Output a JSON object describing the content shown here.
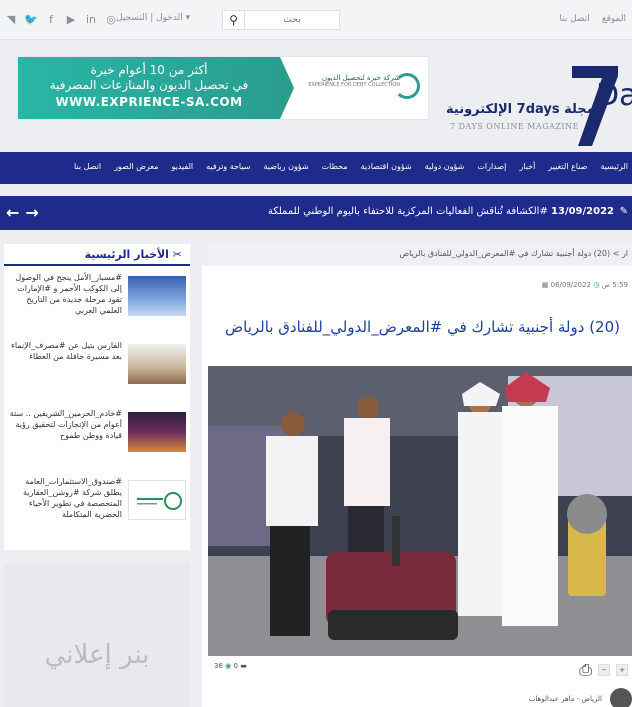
{
  "topbar": {
    "social_icons": [
      "rss-icon",
      "twitter-icon",
      "facebook-icon",
      "youtube-icon",
      "linkedin-icon",
      "instagram-icon"
    ],
    "social_glyphs": [
      "◥",
      "🐦",
      "f",
      "▶",
      "in",
      "◎"
    ],
    "login_text": "▾ الدخول | التسجيل",
    "search_placeholder": "بحث",
    "links": [
      "الموقع",
      "اتصل بنا"
    ]
  },
  "ad": {
    "line1": "أكثر من 10 أعوام خبرة",
    "line2": "في تحصيل الديون والمنازعات المصرفية",
    "url": "WWW.EXPRIENCE-SA.COM",
    "company_ar": "شركة خبرة لتحصيل الديون",
    "company_en": "EXPERIENCE FOR DEBT COLLECTION"
  },
  "logo": {
    "day": "Day",
    "name_ar": "مجلة 7days الإلكترونية",
    "name_en": "7 DAYS ONLINE MAGAZINE"
  },
  "nav": {
    "items": [
      "الرئيسية",
      "صناع التغيير",
      "أخبار",
      "إصدارات",
      "شؤون دولية",
      "شؤون اقتصادية",
      "محطات",
      "شؤون رياضية",
      "سياحة وترفيه",
      "الفيديو",
      "معرض الصور",
      "اتصل بنا"
    ]
  },
  "ticker": {
    "date": "13/09/2022",
    "headline": "#الكشافة تُناقش الفعاليات المركزية للاحتفاء باليوم الوطني للمملكة"
  },
  "sidebar": {
    "title": "الأخبار الرئيسية",
    "items": [
      {
        "text": "#مسبار_الأمل ينجح في الوصول إلى الكوكب الأحمر و #الإمارات تقود مرحلة جديدة من التاريخ العلمي العربي"
      },
      {
        "text": "الفارس بتيل عن #مصرف_الإنماء بعد مسيرة حافلة من العطاء"
      },
      {
        "text": "#خادم_الحرمين_الشريفين .. ستة أعوام من الإنجازات لتحقيق رؤية قيادة ووطن طموح"
      },
      {
        "text": "#صندوق_الاستثمارات_العامة يطلق شركة #روشن_العقارية المتخصصة في تطوير الأحياء الحضرية المتكاملة"
      }
    ],
    "banner_text": "بنر إعلاني"
  },
  "article": {
    "breadcrumb": "ار > (20) دولة أجنبية تشارك في #المعرض_الدولي_للفنادق بالرياض",
    "date": "06/09/2022",
    "time": "5:59 ص",
    "title": "(20) دولة أجنبية تشارك في #المعرض_الدولي_للفنادق بالرياض",
    "views": "36",
    "comments": "0",
    "author": "الرياض - ماهر عبدالوهاب"
  }
}
